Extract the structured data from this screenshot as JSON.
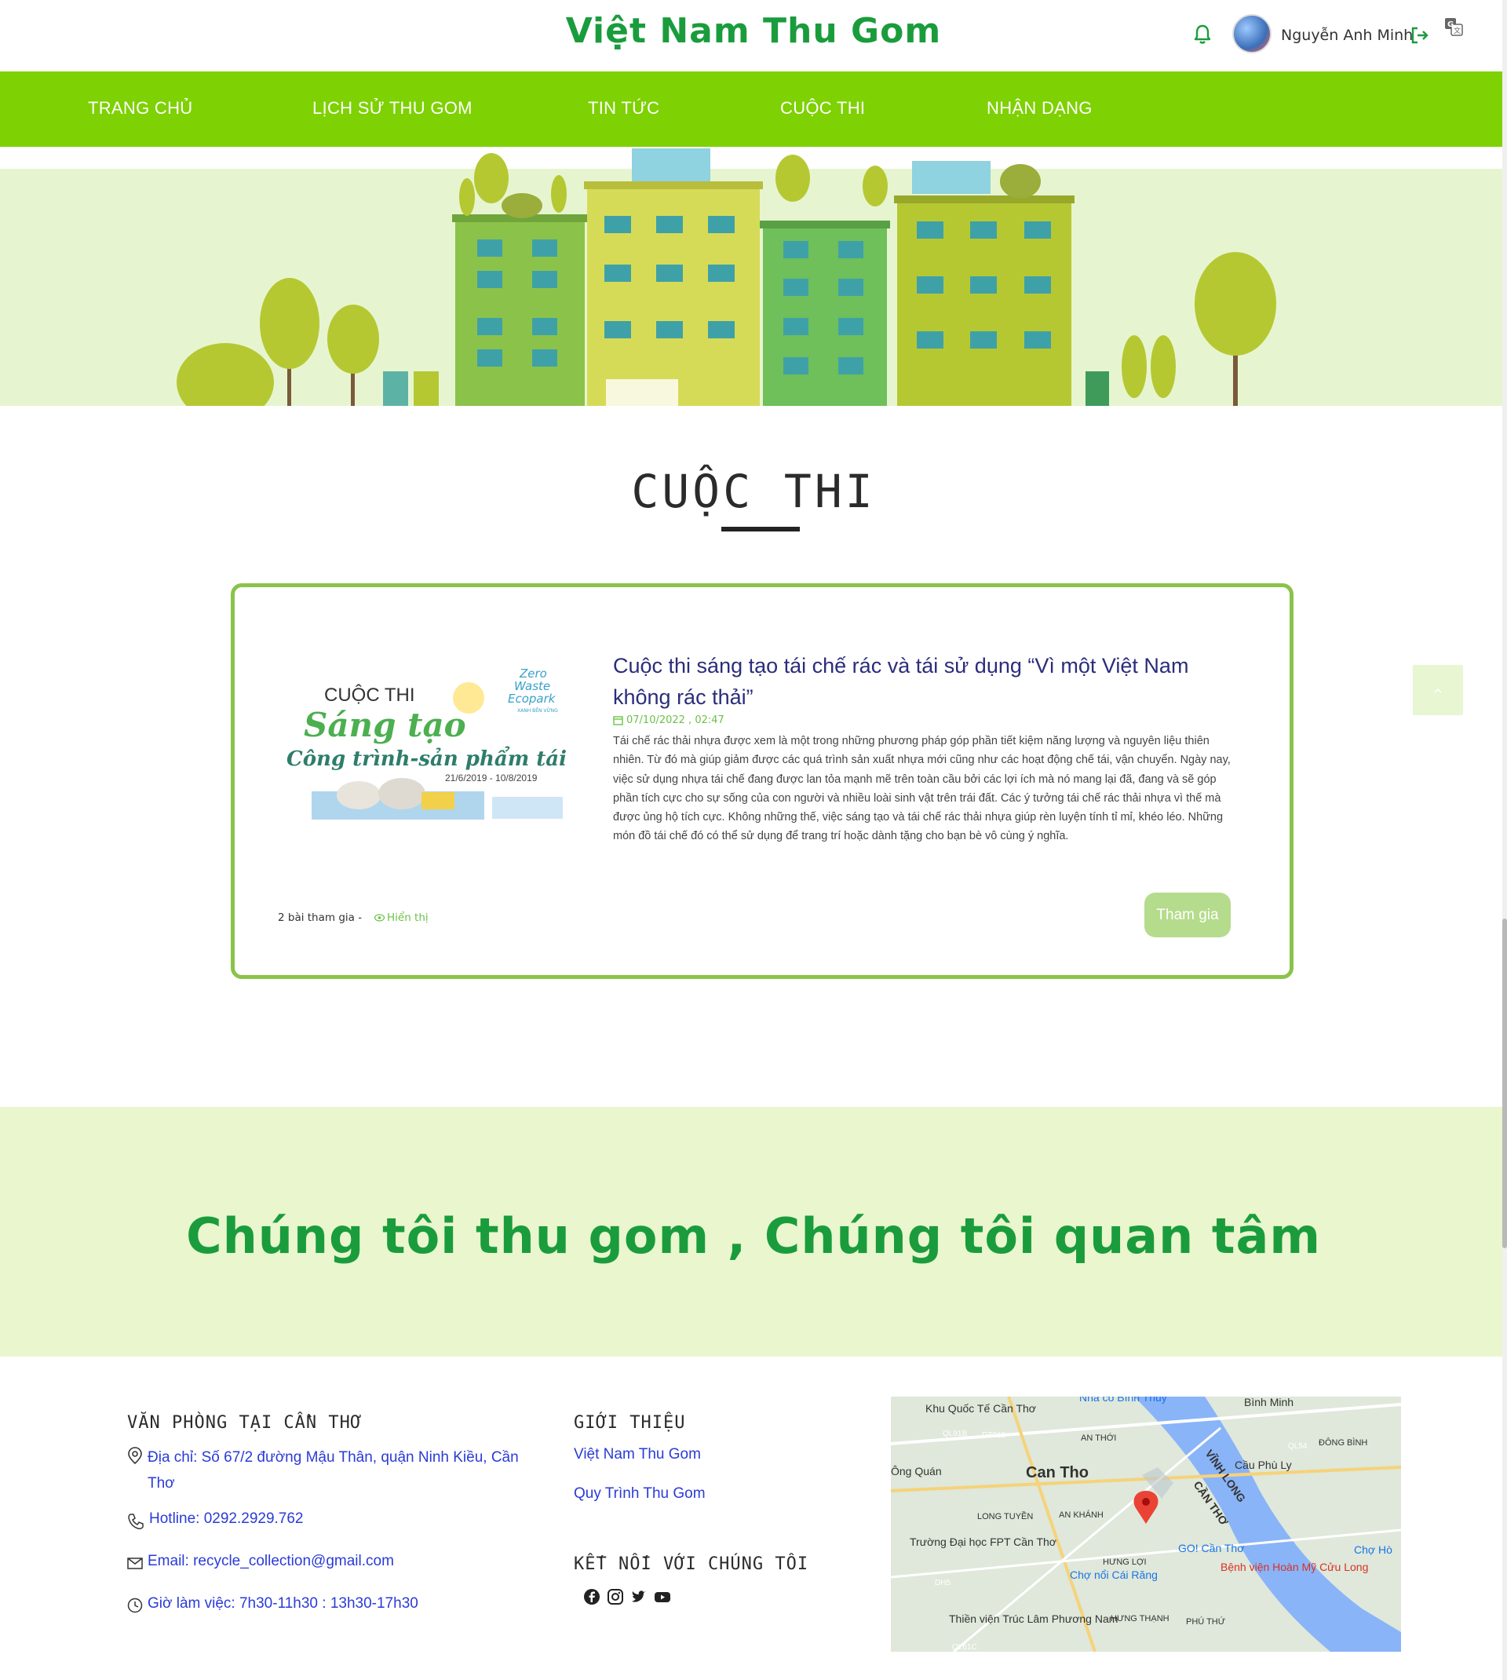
{
  "header": {
    "brand": "Việt Nam Thu Gom",
    "user_name": "Nguyễn Anh Minh",
    "icons": [
      "bell-icon",
      "avatar",
      "logout-icon",
      "translate-icon"
    ]
  },
  "nav": {
    "items": [
      "TRANG CHỦ",
      "LỊCH SỬ THU GOM",
      "TIN TỨC",
      "CUỘC THI",
      "NHẬN DẠNG"
    ]
  },
  "section": {
    "title": "CUỘC THI"
  },
  "contest": {
    "image_text": {
      "line1": "CUỘC THI",
      "line2": "Sáng tạo",
      "line3": "Công trình-sản phẩm tái chế",
      "dates": "21/6/2019 - 10/8/2019",
      "logo1": "Zero",
      "logo2": "Waste",
      "logo3": "Ecopark",
      "logo4": "XANH BỀN VỮNG"
    },
    "title": "Cuộc thi sáng tạo tái chế rác và tái sử dụng “Vì một Việt Nam không rác thải”",
    "date": "07/10/2022 , 02:47",
    "description": "Tái chế rác thải nhựa được xem là một trong những phương pháp góp phần tiết kiệm năng lượng và nguyên liệu thiên nhiên. Từ đó mà giúp giảm được các quá trình sản xuất nhựa mới cũng như các hoạt động chế tái, vận chuyển. Ngày nay, việc sử dụng nhựa tái chế đang được lan tỏa mạnh mẽ trên toàn cầu bởi các lợi ích mà nó mang lại đã, đang và sẽ góp phần tích cực cho sự sống của con người và nhiều loài sinh vật trên trái đất. Các ý tưởng tái chế rác thải nhựa vì thế mà được ủng hộ tích cực. Không những thế, việc sáng tạo và tái chế rác thải nhựa giúp rèn luyện tính tỉ mỉ, khéo léo. Những món đồ tái chế đó có thể sử dụng để trang trí hoặc dành tặng cho bạn bè vô cùng ý nghĩa.",
    "count": "2 bài tham gia -",
    "view_label": "Hiển thị",
    "join_label": "Tham gia"
  },
  "slogan": "Chúng tôi thu gom , Chúng tôi quan tâm",
  "footer": {
    "office_heading": "VĂN PHÒNG TẠI CẦN THƠ",
    "address": "Địa chỉ: Số 67/2 đường Mậu Thân, quận Ninh Kiều, Cần Thơ",
    "hotline": "Hotline: 0292.2929.762",
    "email": "Email: recycle_collection@gmail.com",
    "hours": "Giờ làm việc: 7h30-11h30 : 13h30-17h30",
    "about_heading": "GIỚI THIỆU",
    "about_links": [
      "Việt Nam Thu Gom",
      "Quy Trình Thu Gom"
    ],
    "connect_heading": "KẾT NỐI VỚI CHÚNG TÔI",
    "social_icons": [
      "facebook-icon",
      "instagram-icon",
      "twitter-icon",
      "youtube-icon"
    ]
  },
  "map": {
    "labels": [
      "Bình Minh",
      "Can Tho",
      "CẦN THƠ",
      "VĨNH LONG",
      "Cầu Phù Ly",
      "ĐÔNG BÌNH",
      "AN THỚI",
      "LONG TUYỀN",
      "AN KHÁNH",
      "Trường Đại học FPT Cần Thơ",
      "GO! Cần Thơ",
      "Bệnh viện Hoàn Mỹ Cửu Long",
      "Chợ nổi Cái Răng",
      "HƯNG LỢI",
      "Thiền viện Trúc Lâm Phương Nam",
      "HƯNG THẠNH",
      "PHÚ THỨ",
      "Chợ Hò",
      "Khu Quốc Tế Cần Thơ",
      "Nhà cổ Bình Thủy",
      "Ông Quán",
      "QL91B",
      "DT918",
      "QL54",
      "DH5",
      "QL61C"
    ]
  },
  "colors": {
    "brand_green": "#1a9c3d",
    "nav_green": "#7ed102",
    "card_border": "#8bc34a",
    "title_navy": "#2b2d7a",
    "link_blue": "#2a3bd8",
    "slogan_bg": "#eaf6cd"
  }
}
